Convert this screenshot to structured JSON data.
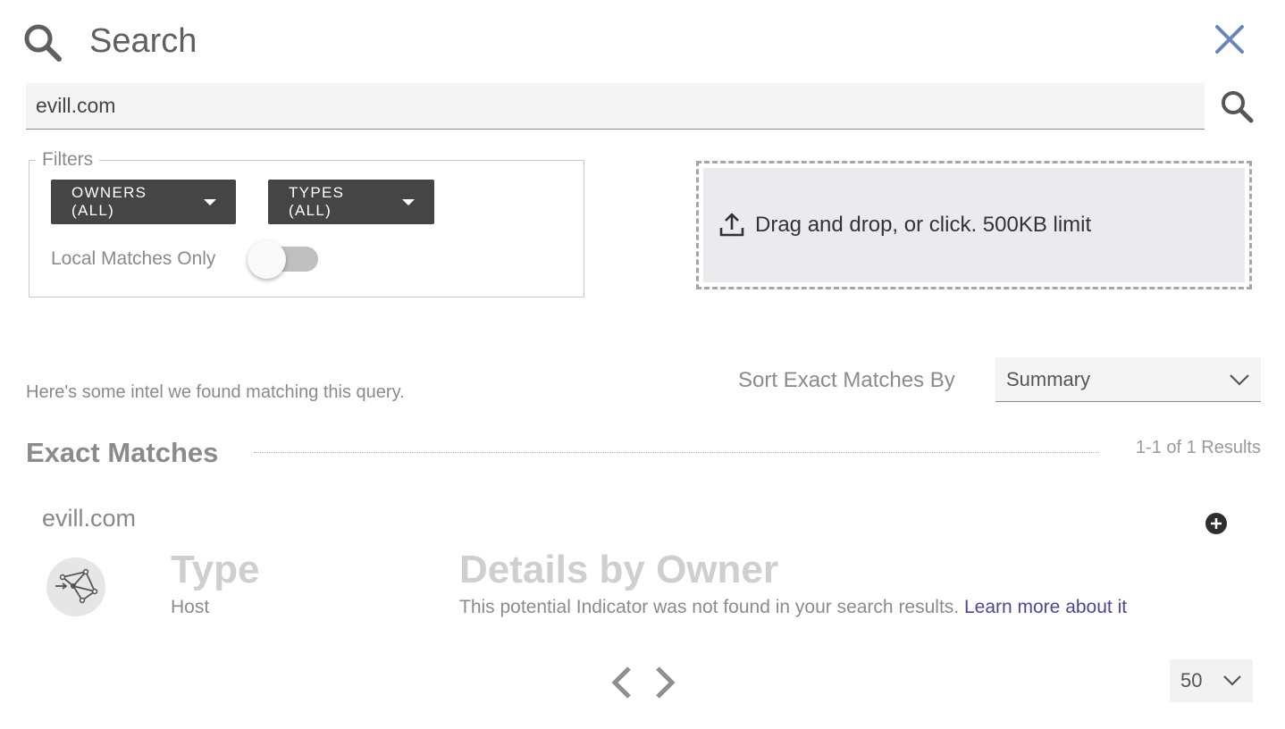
{
  "header": {
    "title": "Search",
    "search_icon": "search-icon",
    "close_icon": "close-icon"
  },
  "search": {
    "value": "evill.com",
    "placeholder": "",
    "submit_icon": "search-icon"
  },
  "filters": {
    "legend": "Filters",
    "owners_label": "OWNERS (ALL)",
    "types_label": "TYPES (ALL)",
    "local_matches_label": "Local Matches Only",
    "local_matches_on": false
  },
  "upload": {
    "icon": "upload-icon",
    "text": "Drag and drop, or click. 500KB limit"
  },
  "results": {
    "intro": "Here's some intel we found matching this query.",
    "sort_label": "Sort Exact Matches By",
    "sort_value": "Summary",
    "section_title": "Exact Matches",
    "count_text": "1-1 of 1 Results",
    "items": [
      {
        "name": "evill.com",
        "icon": "host-network-icon",
        "type_heading": "Type",
        "type_value": "Host",
        "details_heading": "Details by Owner",
        "details_text": "This potential Indicator was not found in your search results.",
        "learn_more": "Learn more about it"
      }
    ]
  },
  "pagination": {
    "per_page": "50"
  },
  "colors": {
    "accent_link": "#4a4797",
    "button_dark": "#454545",
    "close_icon": "#6b86b8",
    "upload_bg": "#ebeaef"
  }
}
